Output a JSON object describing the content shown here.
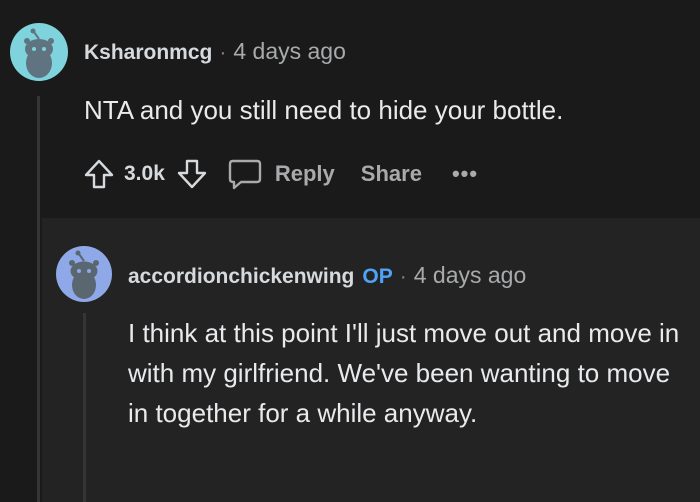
{
  "comment": {
    "username": "Ksharonmcg",
    "separator": "·",
    "time": "4 days ago",
    "body": "NTA and you still need to hide your bottle.",
    "score": "3.0k",
    "reply_label": "Reply",
    "share_label": "Share",
    "more_label": "•••"
  },
  "reply": {
    "username": "accordionchickenwing",
    "badge": "OP",
    "separator": "·",
    "time": "4 days ago",
    "body": "I think at this point I'll just move out and move in with my girlfriend. We've been wanting to move in together for a while anyway."
  },
  "colors": {
    "background": "#1a1a1b",
    "reply_background": "#232324",
    "op_badge": "#4fa3f7",
    "avatar_1": "#7fd3dd",
    "avatar_2": "#8ea8e8"
  },
  "icons": [
    "snoo-avatar-icon",
    "upvote-icon",
    "downvote-icon",
    "comment-bubble-icon",
    "more-options-icon"
  ]
}
